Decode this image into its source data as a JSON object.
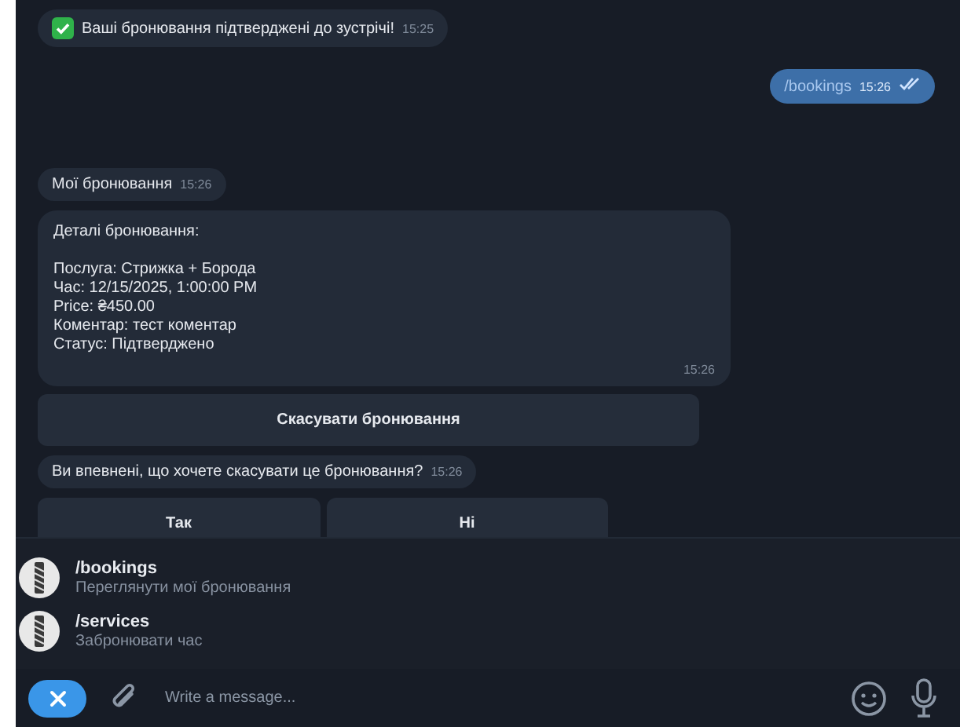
{
  "messages": [
    {
      "kind": "incoming",
      "emoji": true,
      "text": "Ваші бронювання підтверджені до зустрічі!",
      "time": "15:25"
    },
    {
      "kind": "outgoing",
      "text": "/bookings",
      "time": "15:26",
      "read": true
    },
    {
      "kind": "incoming",
      "text": "Мої бронювання",
      "time": "15:26"
    },
    {
      "kind": "details",
      "title": "Деталі бронювання:",
      "lines": [
        "Послуга: Стрижка + Борода",
        "Час: 12/15/2025, 1:00:00 PM",
        "Price: ₴450.00",
        "Коментар: тест коментар",
        "Статус: Підтверджено"
      ],
      "time": "15:26"
    },
    {
      "kind": "buttons",
      "buttons": [
        "Скасувати бронювання"
      ]
    },
    {
      "kind": "incoming",
      "text": "Ви впевнені, що хочете скасувати це бронювання?",
      "time": "15:26"
    },
    {
      "kind": "buttons",
      "buttons": [
        "Так",
        "Ні"
      ]
    }
  ],
  "commands": [
    {
      "command": "/bookings",
      "description": "Переглянути мої бронювання"
    },
    {
      "command": "/services",
      "description": "Забронювати час"
    }
  ],
  "input": {
    "placeholder": "Write a message..."
  }
}
